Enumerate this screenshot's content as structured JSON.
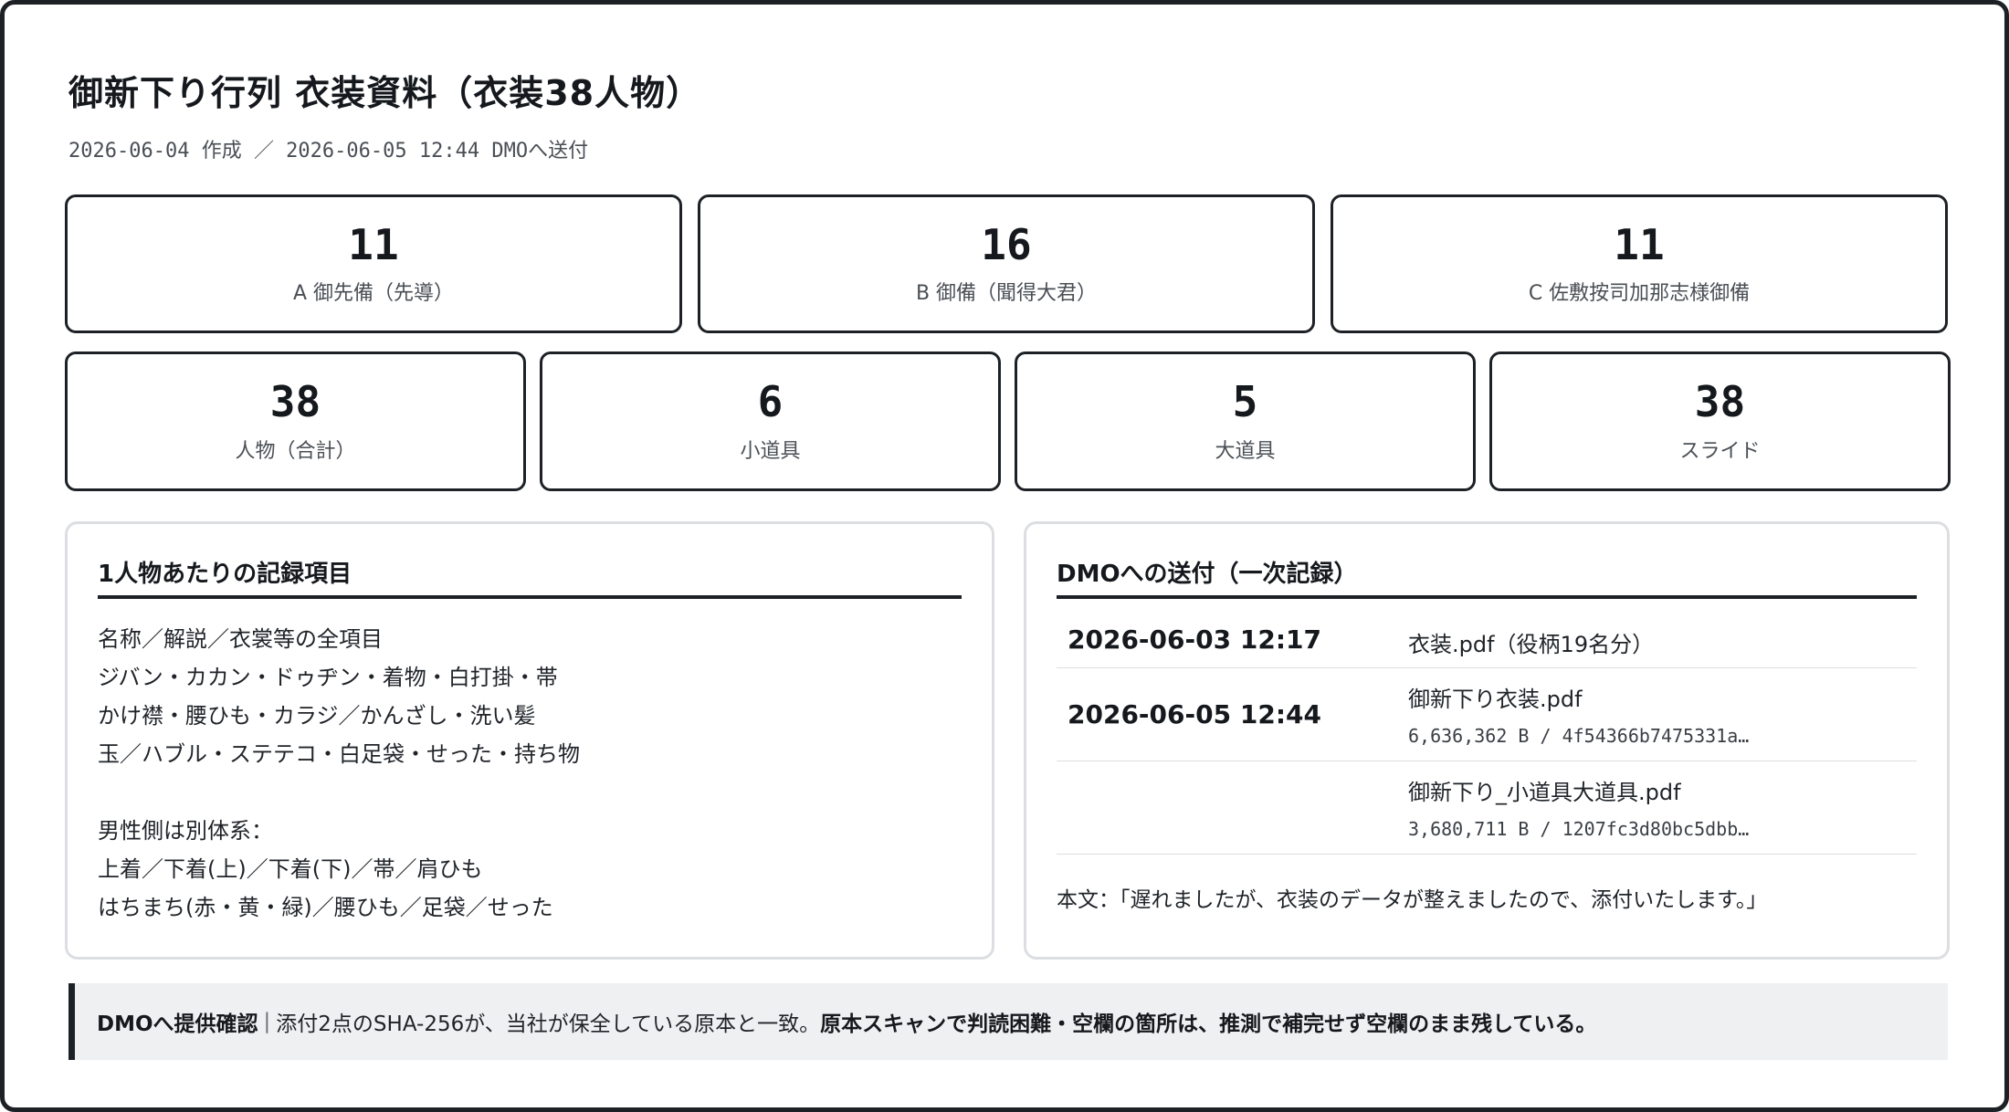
{
  "header": {
    "title": "御新下り行列 衣装資料（衣装38人物）",
    "subtitle": "2026-06-04 作成 ／ 2026-06-05 12:44 DMOへ送付"
  },
  "stats_top": [
    {
      "value": "11",
      "label": "A 御先備（先導）"
    },
    {
      "value": "16",
      "label": "B 御備（聞得大君）"
    },
    {
      "value": "11",
      "label": "C 佐敷按司加那志様御備"
    }
  ],
  "stats_bottom": [
    {
      "value": "38",
      "label": "人物（合計）"
    },
    {
      "value": "6",
      "label": "小道具"
    },
    {
      "value": "5",
      "label": "大道具"
    },
    {
      "value": "38",
      "label": "スライド"
    }
  ],
  "items_panel": {
    "heading": "1人物あたりの記録項目",
    "lines": [
      "名称／解説／衣裳等の全項目",
      "ジバン・カカン・ドゥヂン・着物・白打掛・帯",
      "かけ襟・腰ひも・カラジ／かんざし・洗い髪",
      "玉／ハブル・ステテコ・白足袋・せった・持ち物",
      "",
      "男性側は別体系：",
      "上着／下着(上)／下着(下)／帯／肩ひも",
      "はちまち(赤・黄・緑)／腰ひも／足袋／せった"
    ]
  },
  "dmo_panel": {
    "heading": "DMOへの送付（一次記録）",
    "rows": [
      {
        "date": "2026-06-03 12:17",
        "file": "衣装.pdf（役柄19名分）",
        "meta": ""
      },
      {
        "date": "2026-06-05 12:44",
        "file": "御新下り衣装.pdf",
        "meta": "6,636,362 B / 4f54366b7475331a…"
      },
      {
        "date": "",
        "file": "御新下り_小道具大道具.pdf",
        "meta": "3,680,711 B / 1207fc3d80bc5dbb…"
      }
    ],
    "body": "本文：「遅れましたが、衣装のデータが整えましたので、添付いたします。」"
  },
  "callout": {
    "label": "DMOへ提供確認",
    "separator": "|",
    "text": "添付2点のSHA-256が、当社が保全している原本と一致。",
    "emphasis": "原本スキャンで判読困難・空欄の箇所は、推測で補完せず空欄のまま残している。"
  }
}
